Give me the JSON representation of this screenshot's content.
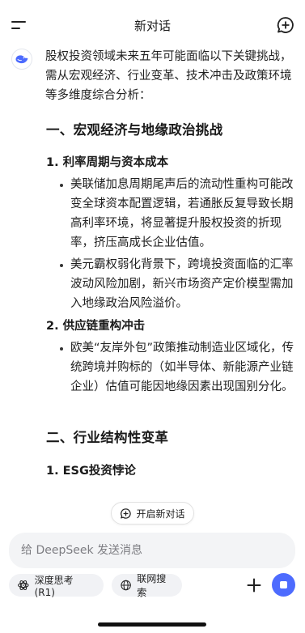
{
  "header": {
    "title": "新对话"
  },
  "message": {
    "intro": "股权投资领域未来五年可能面临以下关键挑战，需从宏观经济、行业变革、技术冲击及政策环境等多维度综合分析：",
    "section1": {
      "heading": "一、宏观经济与地缘政治挑战",
      "sub1": {
        "title": "1. 利率周期与资本成本",
        "bullets": [
          "美联储加息周期尾声后的流动性重构可能改变全球资本配置逻辑，若通胀反复导致长期高利率环境，将显著提升股权投资的折现率，挤压高成长企业估值。",
          "美元霸权弱化背景下，跨境投资面临的汇率波动风险加剧，新兴市场资产定价模型需加入地缘政治风险溢价。"
        ]
      },
      "sub2": {
        "title": "2. 供应链重构冲击",
        "bullets": [
          "欧美“友岸外包”政策推动制造业区域化，传统跨境并购标的（如半导体、新能源产业链企业）估值可能因地缘因素出现国别分化。"
        ]
      }
    },
    "section2": {
      "heading": "二、行业结构性变革",
      "sub1": {
        "title": "1. ESG投资悖论"
      }
    }
  },
  "new_chat_pill": {
    "label": "开启新对话"
  },
  "composer": {
    "placeholder": "给 DeepSeek 发送消息"
  },
  "toolbar": {
    "deep_think_label": "深度思考 (R1)",
    "web_search_label": "联网搜索"
  },
  "colors": {
    "accent": "#4d6bfe",
    "chip_bg": "#f1f2f5",
    "composer_bg": "#f3f4f6"
  },
  "icons": {
    "menu": "menu-icon",
    "new_chat": "new-chat-icon",
    "avatar": "deepseek-whale-icon",
    "deep_think": "atom-icon",
    "web_search": "globe-icon",
    "plus": "plus-icon",
    "stop": "stop-icon"
  }
}
